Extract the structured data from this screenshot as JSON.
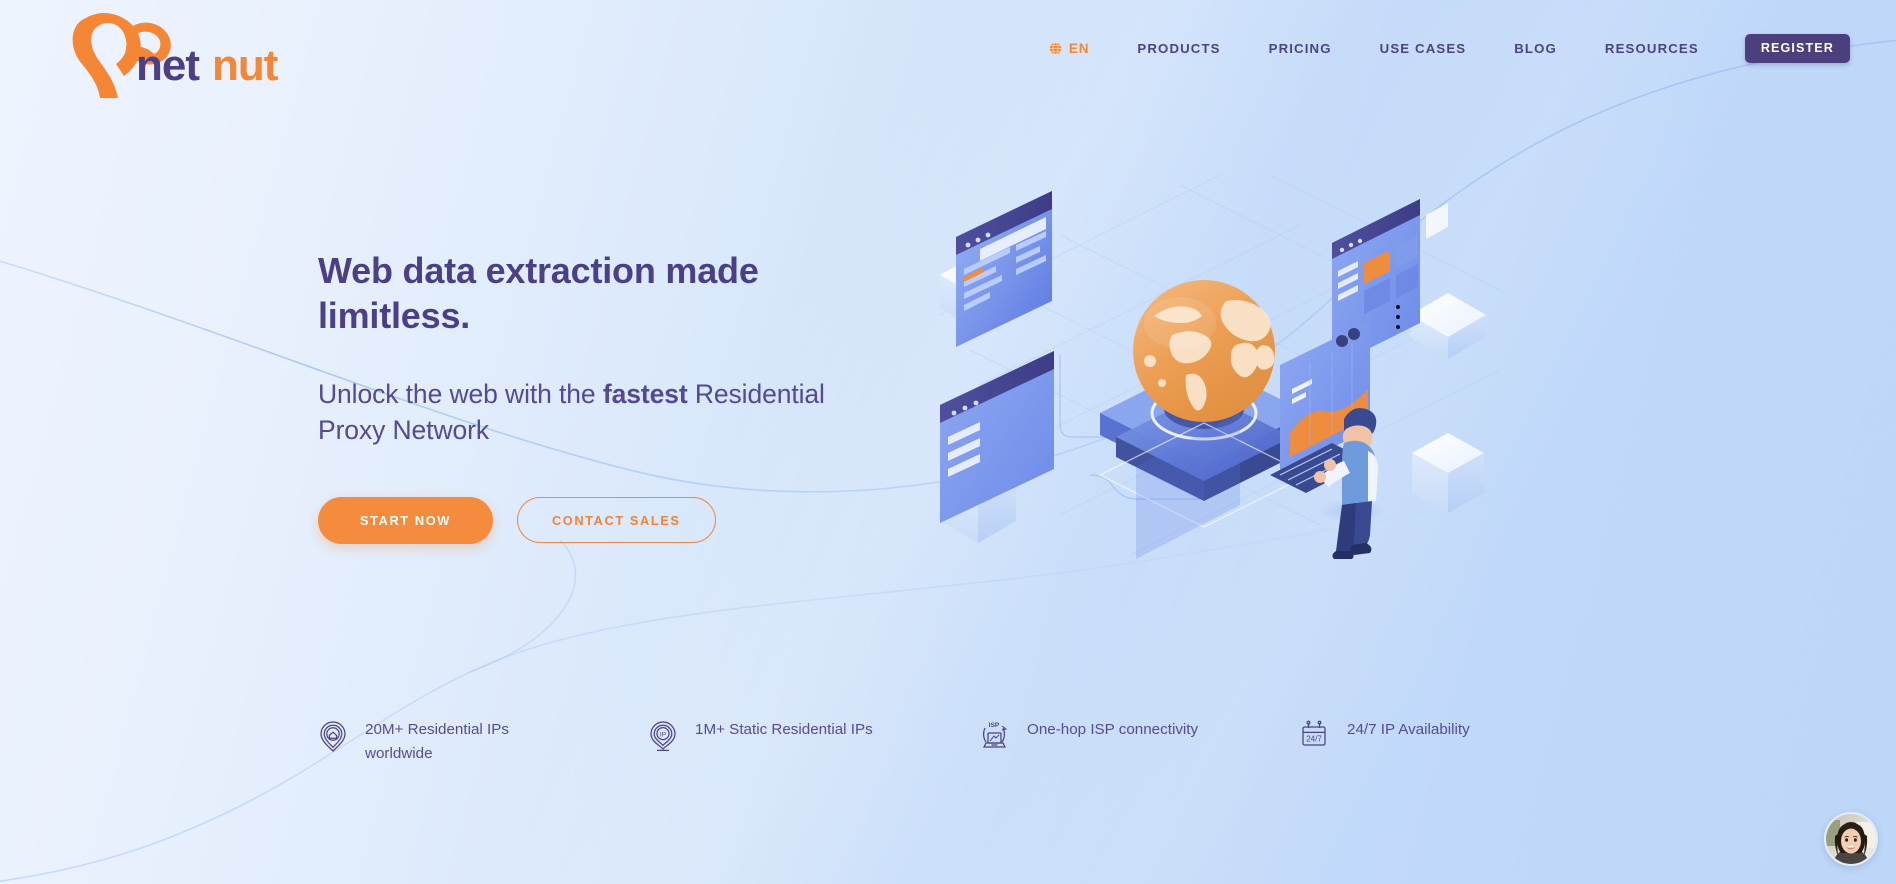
{
  "brand": {
    "logo_text_part1": "net",
    "logo_text_part2": "nut",
    "logo_icon": "squirrel-icon",
    "colors": {
      "orange": "#f58634",
      "purple": "#4b3f87",
      "deep_purple": "#4c3f7e",
      "bg_light": "#eef4fe",
      "bg_blue": "#bed7f8"
    }
  },
  "header": {
    "language": {
      "icon": "globe-icon",
      "label": "EN"
    },
    "nav_items": [
      {
        "label": "PRODUCTS"
      },
      {
        "label": "PRICING"
      },
      {
        "label": "USE CASES"
      },
      {
        "label": "BLOG"
      },
      {
        "label": "RESOURCES"
      }
    ],
    "register_label": "REGISTER"
  },
  "hero": {
    "headline": "Web data extraction made limitless.",
    "subhead_prefix": "Unlock the web with the ",
    "subhead_bold": "fastest",
    "subhead_suffix": " Residential Proxy Network",
    "primary_cta": "START NOW",
    "secondary_cta": "CONTACT SALES"
  },
  "features": [
    {
      "icon": "map-pin-home-icon",
      "label": "20M+ Residential IPs worldwide"
    },
    {
      "icon": "map-pin-ip-icon",
      "label": "1M+ Static Residential IPs"
    },
    {
      "icon": "laptop-isp-icon",
      "label": "One-hop ISP connectivity"
    },
    {
      "icon": "calendar-247-icon",
      "label": "24/7 IP Availability"
    }
  ],
  "illustration": {
    "name": "isometric-global-proxy-network-illustration",
    "elements": [
      "orange-globe",
      "isometric-pedestal",
      "browser-windows",
      "dashboard-screen",
      "person-at-terminal",
      "white-cubes",
      "connection-lines"
    ]
  },
  "chat_widget": {
    "name": "support-agent-avatar"
  }
}
